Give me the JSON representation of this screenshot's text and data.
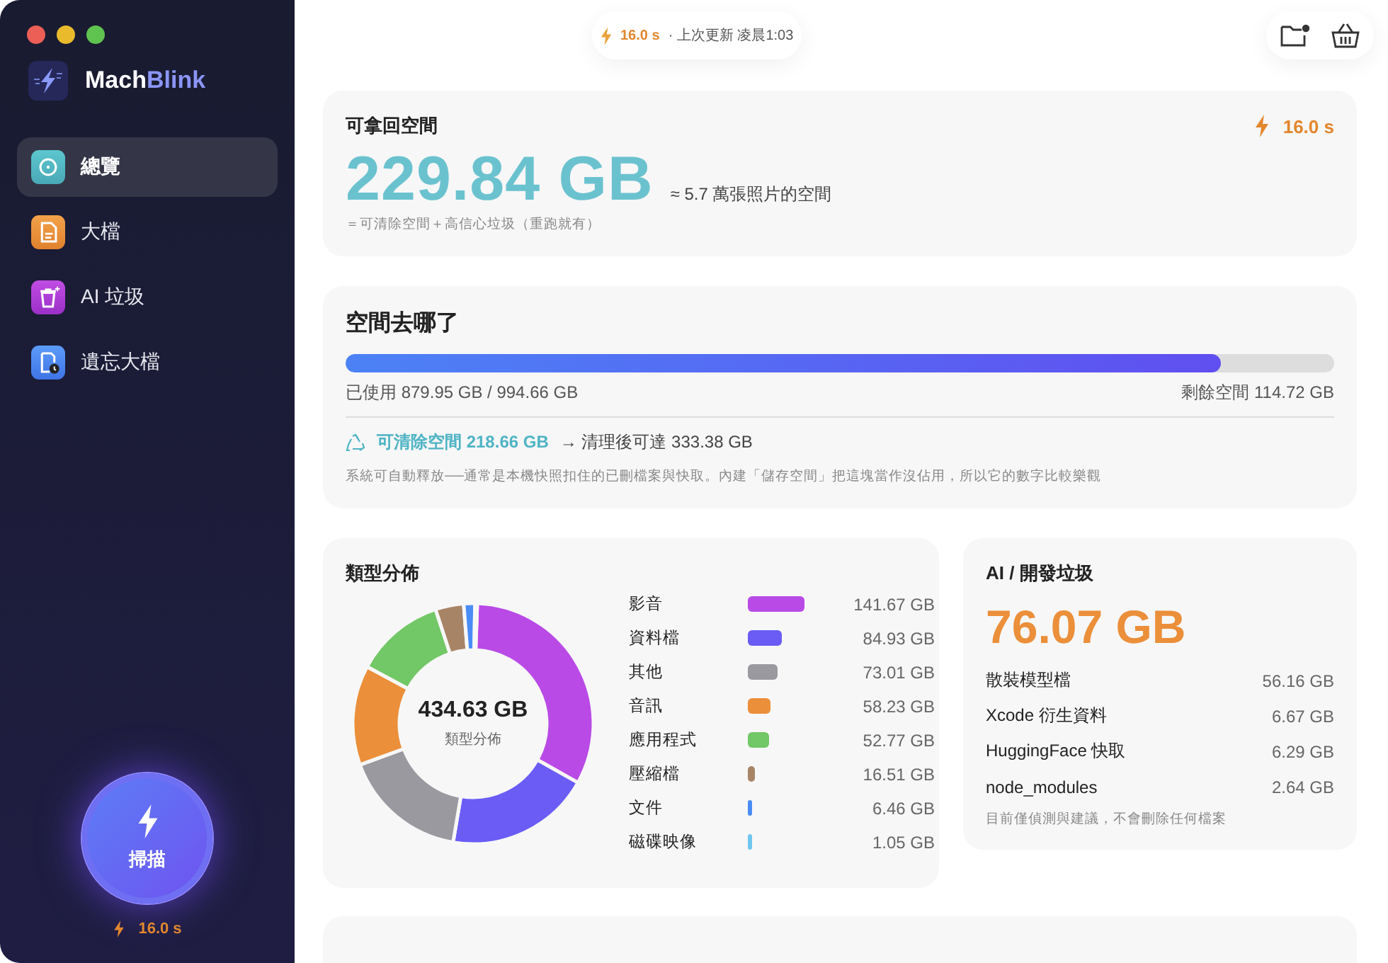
{
  "sidebar": {
    "brand_start": "Mach",
    "brand_end": "Blink",
    "nav": [
      {
        "label": "總覽",
        "kind": "overview",
        "selected": true
      },
      {
        "label": "大檔",
        "kind": "file",
        "selected": false
      },
      {
        "label": "AI 垃圾",
        "kind": "trash",
        "selected": false
      },
      {
        "label": "遺忘大檔",
        "kind": "forgotten",
        "selected": false
      }
    ],
    "scan_button": {
      "label": "掃描"
    },
    "scan_time": "16.0 s"
  },
  "status_pill": {
    "time": "16.0 s",
    "updated": "· 上次更新 凌晨1:03"
  },
  "reclaimable": {
    "title": "可拿回空間",
    "time": "16.0 s",
    "amount": "229.84 GB",
    "equivalent": "≈ 5.7 萬張照片的空間",
    "note": "＝可清除空間＋高信心垃圾（重跑就有）"
  },
  "usage": {
    "title": "空間去哪了",
    "level": 0.885,
    "used": "已使用 879.95 GB / 994.66 GB",
    "free": "剩餘空間 114.72 GB",
    "purgeable": "可清除空間 218.66 GB",
    "after": "→ 清理後可達 333.38 GB",
    "note": "系統可自動釋放──通常是本機快照扣住的已刪檔案與快取。內建「儲存空間」把這塊當作沒佔用，所以它的數字比較樂觀"
  },
  "types": {
    "title": "類型分佈",
    "total": "434.63 GB",
    "total_label": "類型分佈",
    "chart_data": {
      "type": "donut",
      "categories": [
        "影音",
        "資料檔",
        "其他",
        "音訊",
        "應用程式",
        "壓縮檔",
        "文件",
        "磁碟映像"
      ],
      "values": [
        32.6,
        19.5,
        16.8,
        13.4,
        12.1,
        3.8,
        1.5,
        0.3
      ]
    },
    "legend": [
      {
        "size": "141.67 GB",
        "color": "#b94ae6"
      },
      {
        "size": "84.93 GB",
        "color": "#6a5cf5"
      },
      {
        "size": "73.01 GB",
        "color": "#9a99a0"
      },
      {
        "size": "58.23 GB",
        "color": "#eb8f3a"
      },
      {
        "size": "52.77 GB",
        "color": "#72c766"
      },
      {
        "size": "16.51 GB",
        "color": "#a88466"
      },
      {
        "size": "6.46 GB",
        "color": "#4a8cf7"
      },
      {
        "size": "1.05 GB",
        "color": "#6fc7f0"
      }
    ]
  },
  "ai_junk": {
    "title": "AI / 開發垃圾",
    "amount": "76.07 GB",
    "items": [
      {
        "label": "散裝模型檔",
        "size": "56.16 GB"
      },
      {
        "label": "Xcode 衍生資料",
        "size": "6.67 GB"
      },
      {
        "label": "HuggingFace 快取",
        "size": "6.29 GB"
      },
      {
        "label": "node_modules",
        "size": "2.64 GB"
      }
    ],
    "note": "目前僅偵測與建議，不會刪除任何檔案"
  }
}
